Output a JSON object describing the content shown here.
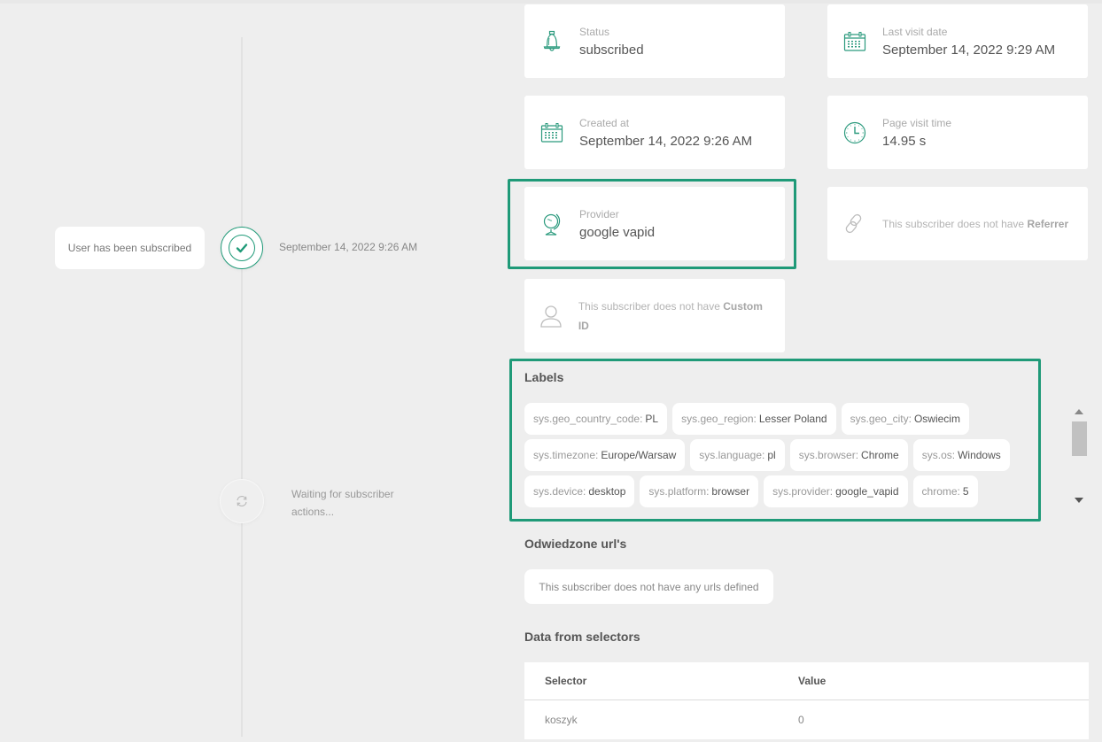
{
  "timeline": {
    "events": [
      {
        "label": "User has been subscribed",
        "date": "September 14, 2022 9:26 AM",
        "state": "done"
      },
      {
        "label": "Waiting for subscriber actions...",
        "state": "waiting"
      }
    ]
  },
  "cards": {
    "status": {
      "label": "Status",
      "value": "subscribed",
      "icon": "bell-icon"
    },
    "last_visit": {
      "label": "Last visit date",
      "value": "September 14, 2022 9:29 AM",
      "icon": "calendar-icon"
    },
    "created_at": {
      "label": "Created at",
      "value": "September 14, 2022 9:26 AM",
      "icon": "calendar-icon"
    },
    "page_visit_time": {
      "label": "Page visit time",
      "value": "14.95 s",
      "icon": "clock-icon"
    },
    "provider": {
      "label": "Provider",
      "value": "google vapid",
      "icon": "globe-icon"
    },
    "referrer": {
      "empty_prefix": "This subscriber does not have",
      "empty_field": "Referrer",
      "icon": "link-icon"
    },
    "custom_id": {
      "empty_prefix": "This subscriber does not have",
      "empty_field": "Custom ID",
      "icon": "user-icon"
    }
  },
  "labels": {
    "title": "Labels",
    "rows": [
      [
        {
          "key": "sys.geo_country_code:",
          "value": "PL"
        },
        {
          "key": "sys.geo_region:",
          "value": "Lesser Poland"
        },
        {
          "key": "sys.geo_city:",
          "value": "Oswiecim"
        }
      ],
      [
        {
          "key": "sys.timezone:",
          "value": "Europe/Warsaw"
        },
        {
          "key": "sys.language:",
          "value": "pl"
        },
        {
          "key": "sys.browser:",
          "value": "Chrome"
        },
        {
          "key": "sys.os:",
          "value": "Windows"
        }
      ],
      [
        {
          "key": "sys.device:",
          "value": "desktop"
        },
        {
          "key": "sys.platform:",
          "value": "browser"
        },
        {
          "key": "sys.provider:",
          "value": "google_vapid"
        },
        {
          "key": "chrome:",
          "value": "5"
        }
      ]
    ]
  },
  "urls": {
    "title": "Odwiedzone url's",
    "empty": "This subscriber does not have any urls defined"
  },
  "selectors": {
    "title": "Data from selectors",
    "columns": [
      "Selector",
      "Value"
    ],
    "rows": [
      [
        "koszyk",
        "0"
      ]
    ]
  },
  "colors": {
    "accent": "#1f9a78",
    "background": "#eeeeee"
  }
}
